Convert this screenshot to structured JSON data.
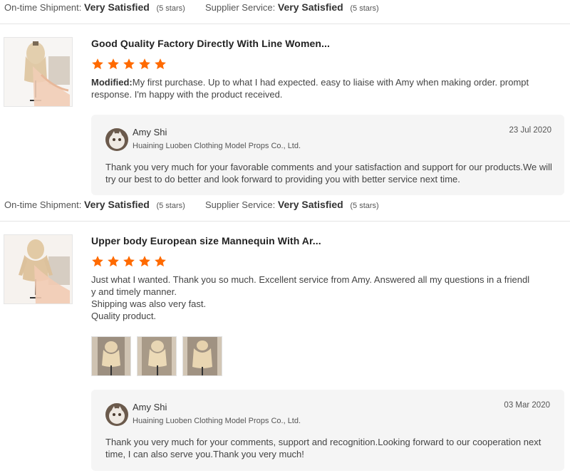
{
  "labels": {
    "ontime": "On-time Shipment:",
    "supplier": "Supplier Service:",
    "satisfied": "Very Satisfied",
    "stars_note": "(5 stars)"
  },
  "colors": {
    "star": "#ff6a00",
    "reply_bg": "#f5f5f5"
  },
  "reviews": [
    {
      "product_title": "Good Quality Factory Directly With Line Women...",
      "rating": 5,
      "modified_label": "Modified:",
      "text": "My first purchase. Up to what I had expected. easy to liaise with Amy when making order. prompt response. I'm happy with the product received.",
      "reply": {
        "name": "Amy Shi",
        "company": "Huaining Luoben Clothing Model Props Co., Ltd.",
        "date": "23 Jul 2020",
        "text": "Thank you very much for your favorable comments and your satisfaction and support for our products.We will try our best to do better and look forward to providing you with better service next time."
      }
    },
    {
      "product_title": "Upper body European size Mannequin With Ar...",
      "rating": 5,
      "text_line1": "Just what I wanted. Thank you so much. Excellent service from Amy. Answered all my questions in a friendl",
      "text_line2": "y and timely manner.",
      "text_line3": "Shipping was also very fast.",
      "text_line4": "Quality product.",
      "photos": [
        "mannequin-photo",
        "mannequin-photo",
        "mannequin-photo"
      ],
      "reply": {
        "name": "Amy Shi",
        "company": "Huaining Luoben Clothing Model Props Co., Ltd.",
        "date": "03 Mar 2020",
        "text": "Thank you very much for your comments, support and recognition.Looking forward to our cooperation next time, I can also serve you.Thank you very much!"
      }
    }
  ]
}
